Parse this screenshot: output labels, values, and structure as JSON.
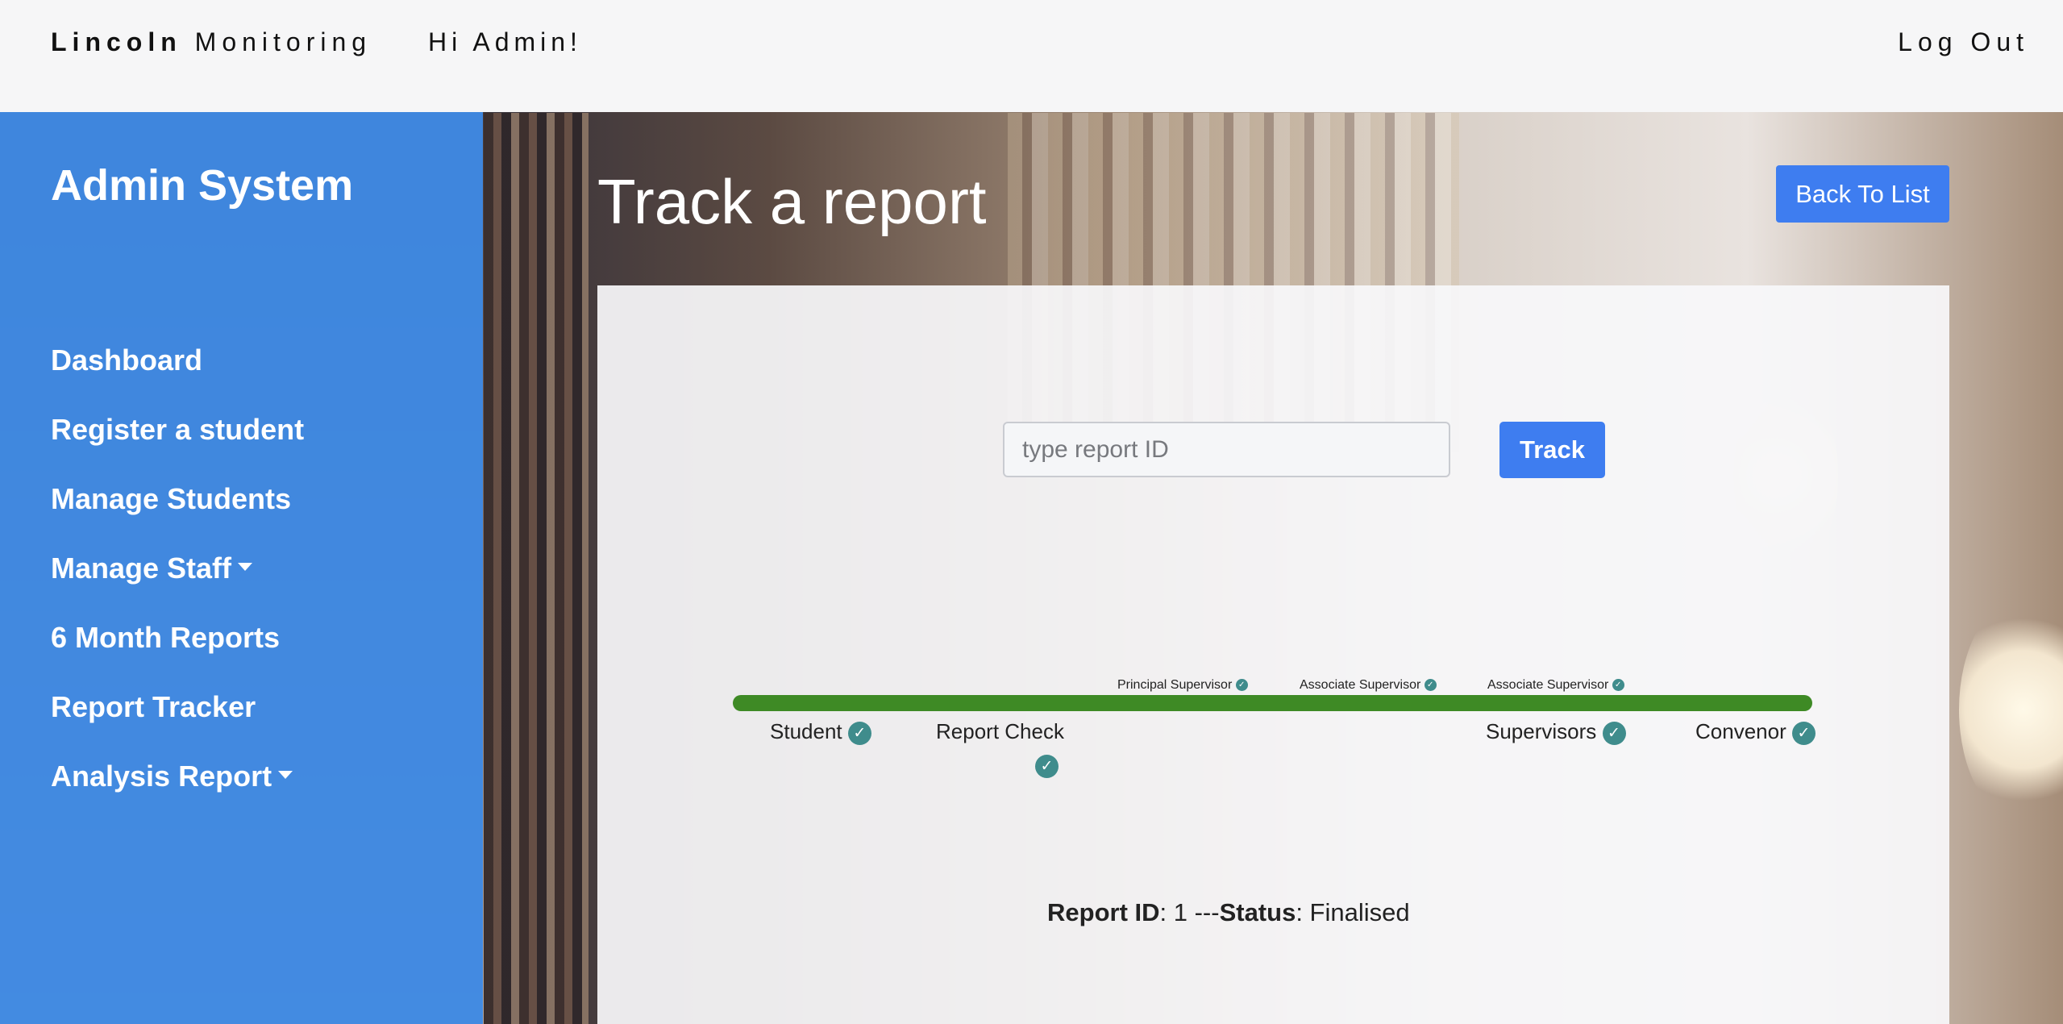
{
  "navbar": {
    "brand_bold": "Lincoln",
    "brand_rest": "Monitoring",
    "greeting": "Hi Admin!",
    "logout_label": "Log Out"
  },
  "sidebar": {
    "title": "Admin System",
    "items": [
      {
        "label": "Dashboard",
        "has_dropdown": false
      },
      {
        "label": "Register a student",
        "has_dropdown": false
      },
      {
        "label": "Manage Students",
        "has_dropdown": false
      },
      {
        "label": "Manage Staff",
        "has_dropdown": true
      },
      {
        "label": "6 Month Reports",
        "has_dropdown": false
      },
      {
        "label": "Report Tracker",
        "has_dropdown": false
      },
      {
        "label": "Analysis Report",
        "has_dropdown": true
      }
    ]
  },
  "main": {
    "title": "Track a report",
    "back_label": "Back To List",
    "search": {
      "placeholder": "type report ID",
      "value": ""
    },
    "track_label": "Track",
    "tracker": {
      "supervisor_checks": [
        "Principal Supervisor",
        "Associate Supervisor",
        "Associate Supervisor"
      ],
      "stages": [
        "Student",
        "Report Check",
        "Supervisors",
        "Convenor"
      ]
    },
    "status": {
      "id_label": "Report ID",
      "id_value": ": 1 ---",
      "status_label": "Status",
      "status_value": ": Finalised"
    }
  },
  "icons": {
    "check": "check-circle-icon",
    "caret": "caret-down-icon"
  },
  "colors": {
    "accent": "#3e7df0",
    "sidebar": "#3e89e4",
    "progress": "#3e8a25",
    "check": "#3f8c8c"
  }
}
